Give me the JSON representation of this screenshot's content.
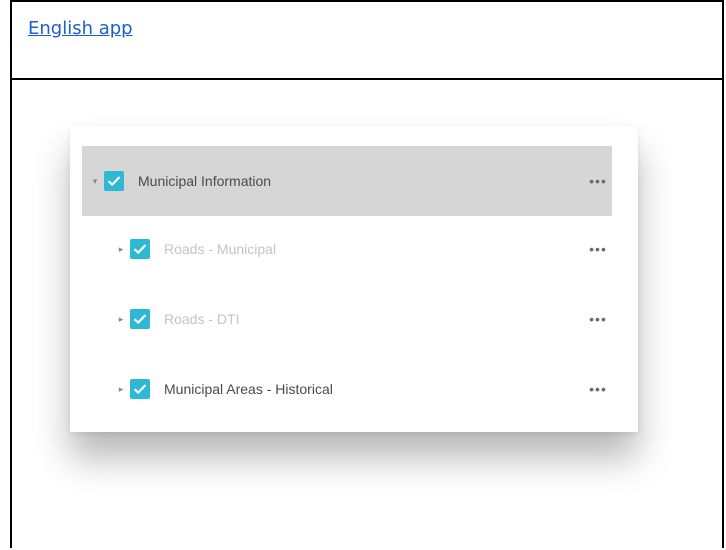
{
  "header": {
    "link_text": "English app"
  },
  "layer_list": {
    "items": [
      {
        "label": "Municipal Information",
        "checked": true,
        "expanded": true,
        "selected": true,
        "dimmed": false,
        "more_icon": "more-horizontal-icon"
      },
      {
        "label": "Roads - Municipal",
        "checked": true,
        "expanded": false,
        "selected": false,
        "dimmed": true,
        "more_icon": "more-horizontal-icon"
      },
      {
        "label": "Roads - DTI",
        "checked": true,
        "expanded": false,
        "selected": false,
        "dimmed": true,
        "more_icon": "more-horizontal-icon"
      },
      {
        "label": "Municipal Areas - Historical",
        "checked": true,
        "expanded": false,
        "selected": false,
        "dimmed": false,
        "more_icon": "more-horizontal-icon"
      }
    ]
  },
  "colors": {
    "link": "#1a5fd0",
    "checkbox": "#2db8d4",
    "selected_row": "#d6d6d6",
    "label": "#4a4a4a",
    "dimmed_label": "#c4c4c4"
  }
}
